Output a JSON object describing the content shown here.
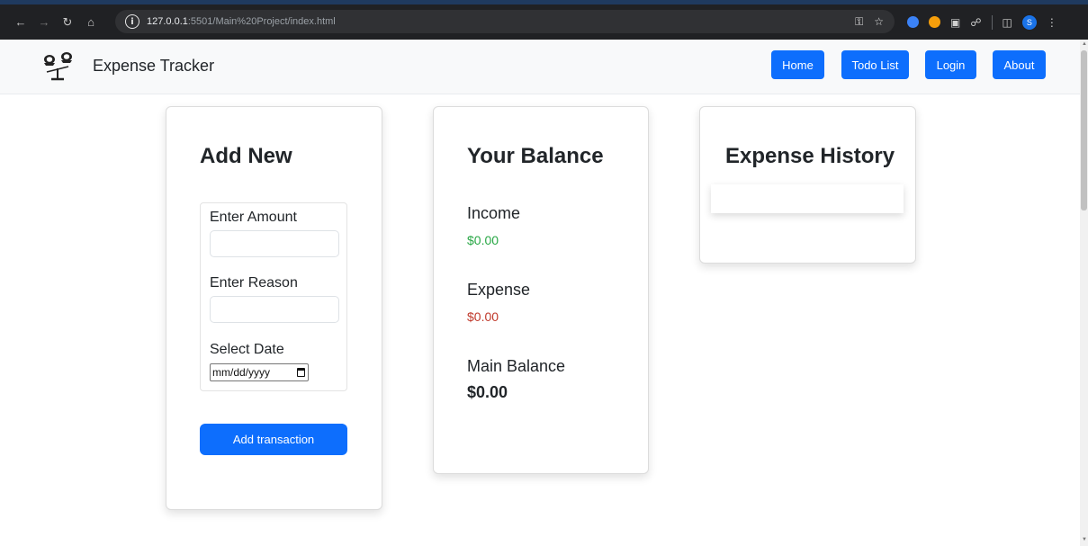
{
  "browser": {
    "url_host": "127.0.0.1",
    "url_rest": ":5501/Main%20Project/index.html",
    "profile_initial": "S"
  },
  "navbar": {
    "brand": "Expense Tracker",
    "links": [
      "Home",
      "Todo List",
      "Login",
      "About"
    ]
  },
  "add_new": {
    "title": "Add New",
    "amount_label": "Enter Amount",
    "reason_label": "Enter Reason",
    "date_label": "Select Date",
    "date_placeholder": "mm/dd/yyyy",
    "button": "Add transaction"
  },
  "balance": {
    "title": "Your Balance",
    "income_label": "Income",
    "income_value": "$0.00",
    "expense_label": "Expense",
    "expense_value": "$0.00",
    "main_label": "Main Balance",
    "main_value": "$0.00"
  },
  "history": {
    "title": "Expense History"
  },
  "colors": {
    "primary": "#0d6efd",
    "income": "#28a745",
    "expense": "#c0392b"
  }
}
